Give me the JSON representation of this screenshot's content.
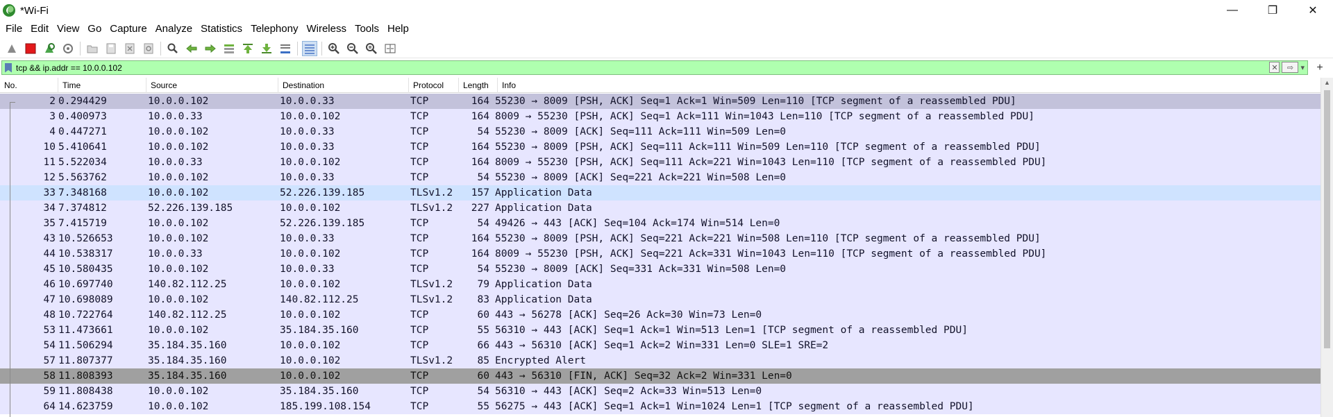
{
  "window": {
    "title": "*Wi-Fi",
    "controls": {
      "minimize": "—",
      "maximize": "❐",
      "close": "✕"
    }
  },
  "menu": [
    "File",
    "Edit",
    "View",
    "Go",
    "Capture",
    "Analyze",
    "Statistics",
    "Telephony",
    "Wireless",
    "Tools",
    "Help"
  ],
  "toolbar": {
    "icons": [
      "shark-fin-start-icon",
      "stop-capture-icon",
      "restart-capture-icon",
      "capture-options-icon",
      "open-file-icon",
      "save-file-icon",
      "close-file-icon",
      "reload-file-icon",
      "find-packet-icon",
      "go-back-icon",
      "go-forward-icon",
      "go-to-packet-icon",
      "go-first-icon",
      "go-last-icon",
      "autoscroll-icon",
      "colorize-icon",
      "zoom-in-icon",
      "zoom-out-icon",
      "zoom-normal-icon",
      "resize-columns-icon"
    ]
  },
  "filter": {
    "value": "tcp && ip.addr == 10.0.0.102",
    "clear_label": "✕",
    "apply_label": "⇨",
    "dropdown_label": "▾",
    "add_label": "+"
  },
  "columns": [
    "No.",
    "Time",
    "Source",
    "Destination",
    "Protocol",
    "Length",
    "Info"
  ],
  "packets": [
    {
      "no": "2",
      "time": "0.294429",
      "src": "10.0.0.102",
      "dst": "10.0.0.33",
      "proto": "TCP",
      "len": "164",
      "info": "55230 → 8009 [PSH, ACK] Seq=1 Ack=1 Win=509 Len=110 [TCP segment of a reassembled PDU]"
    },
    {
      "no": "3",
      "time": "0.400973",
      "src": "10.0.0.33",
      "dst": "10.0.0.102",
      "proto": "TCP",
      "len": "164",
      "info": "8009 → 55230 [PSH, ACK] Seq=1 Ack=111 Win=1043 Len=110 [TCP segment of a reassembled PDU]"
    },
    {
      "no": "4",
      "time": "0.447271",
      "src": "10.0.0.102",
      "dst": "10.0.0.33",
      "proto": "TCP",
      "len": "54",
      "info": "55230 → 8009 [ACK] Seq=111 Ack=111 Win=509 Len=0"
    },
    {
      "no": "10",
      "time": "5.410641",
      "src": "10.0.0.102",
      "dst": "10.0.0.33",
      "proto": "TCP",
      "len": "164",
      "info": "55230 → 8009 [PSH, ACK] Seq=111 Ack=111 Win=509 Len=110 [TCP segment of a reassembled PDU]"
    },
    {
      "no": "11",
      "time": "5.522034",
      "src": "10.0.0.33",
      "dst": "10.0.0.102",
      "proto": "TCP",
      "len": "164",
      "info": "8009 → 55230 [PSH, ACK] Seq=111 Ack=221 Win=1043 Len=110 [TCP segment of a reassembled PDU]"
    },
    {
      "no": "12",
      "time": "5.563762",
      "src": "10.0.0.102",
      "dst": "10.0.0.33",
      "proto": "TCP",
      "len": "54",
      "info": "55230 → 8009 [ACK] Seq=221 Ack=221 Win=508 Len=0"
    },
    {
      "no": "33",
      "time": "7.348168",
      "src": "10.0.0.102",
      "dst": "52.226.139.185",
      "proto": "TLSv1.2",
      "len": "157",
      "info": "Application Data"
    },
    {
      "no": "34",
      "time": "7.374812",
      "src": "52.226.139.185",
      "dst": "10.0.0.102",
      "proto": "TLSv1.2",
      "len": "227",
      "info": "Application Data"
    },
    {
      "no": "35",
      "time": "7.415719",
      "src": "10.0.0.102",
      "dst": "52.226.139.185",
      "proto": "TCP",
      "len": "54",
      "info": "49426 → 443 [ACK] Seq=104 Ack=174 Win=514 Len=0"
    },
    {
      "no": "43",
      "time": "10.526653",
      "src": "10.0.0.102",
      "dst": "10.0.0.33",
      "proto": "TCP",
      "len": "164",
      "info": "55230 → 8009 [PSH, ACK] Seq=221 Ack=221 Win=508 Len=110 [TCP segment of a reassembled PDU]"
    },
    {
      "no": "44",
      "time": "10.538317",
      "src": "10.0.0.33",
      "dst": "10.0.0.102",
      "proto": "TCP",
      "len": "164",
      "info": "8009 → 55230 [PSH, ACK] Seq=221 Ack=331 Win=1043 Len=110 [TCP segment of a reassembled PDU]"
    },
    {
      "no": "45",
      "time": "10.580435",
      "src": "10.0.0.102",
      "dst": "10.0.0.33",
      "proto": "TCP",
      "len": "54",
      "info": "55230 → 8009 [ACK] Seq=331 Ack=331 Win=508 Len=0"
    },
    {
      "no": "46",
      "time": "10.697740",
      "src": "140.82.112.25",
      "dst": "10.0.0.102",
      "proto": "TLSv1.2",
      "len": "79",
      "info": "Application Data"
    },
    {
      "no": "47",
      "time": "10.698089",
      "src": "10.0.0.102",
      "dst": "140.82.112.25",
      "proto": "TLSv1.2",
      "len": "83",
      "info": "Application Data"
    },
    {
      "no": "48",
      "time": "10.722764",
      "src": "140.82.112.25",
      "dst": "10.0.0.102",
      "proto": "TCP",
      "len": "60",
      "info": "443 → 56278 [ACK] Seq=26 Ack=30 Win=73 Len=0"
    },
    {
      "no": "53",
      "time": "11.473661",
      "src": "10.0.0.102",
      "dst": "35.184.35.160",
      "proto": "TCP",
      "len": "55",
      "info": "56310 → 443 [ACK] Seq=1 Ack=1 Win=513 Len=1 [TCP segment of a reassembled PDU]"
    },
    {
      "no": "54",
      "time": "11.506294",
      "src": "35.184.35.160",
      "dst": "10.0.0.102",
      "proto": "TCP",
      "len": "66",
      "info": "443 → 56310 [ACK] Seq=1 Ack=2 Win=331 Len=0 SLE=1 SRE=2"
    },
    {
      "no": "57",
      "time": "11.807377",
      "src": "35.184.35.160",
      "dst": "10.0.0.102",
      "proto": "TLSv1.2",
      "len": "85",
      "info": "Encrypted Alert"
    },
    {
      "no": "58",
      "time": "11.808393",
      "src": "35.184.35.160",
      "dst": "10.0.0.102",
      "proto": "TCP",
      "len": "60",
      "info": "443 → 56310 [FIN, ACK] Seq=32 Ack=2 Win=331 Len=0"
    },
    {
      "no": "59",
      "time": "11.808438",
      "src": "10.0.0.102",
      "dst": "35.184.35.160",
      "proto": "TCP",
      "len": "54",
      "info": "56310 → 443 [ACK] Seq=2 Ack=33 Win=513 Len=0"
    },
    {
      "no": "64",
      "time": "14.623759",
      "src": "10.0.0.102",
      "dst": "185.199.108.154",
      "proto": "TCP",
      "len": "55",
      "info": "56275 → 443 [ACK] Seq=1 Ack=1 Win=1024 Len=1 [TCP segment of a reassembled PDU]"
    }
  ],
  "colors": {
    "filter_valid_bg": "#afffaf",
    "tcp_row_bg": "#e7e6ff",
    "tls_selected_bg": "#cfe3ff",
    "fin_row_bg": "#a0a0a0",
    "first_row_bg": "#c3c2db"
  }
}
